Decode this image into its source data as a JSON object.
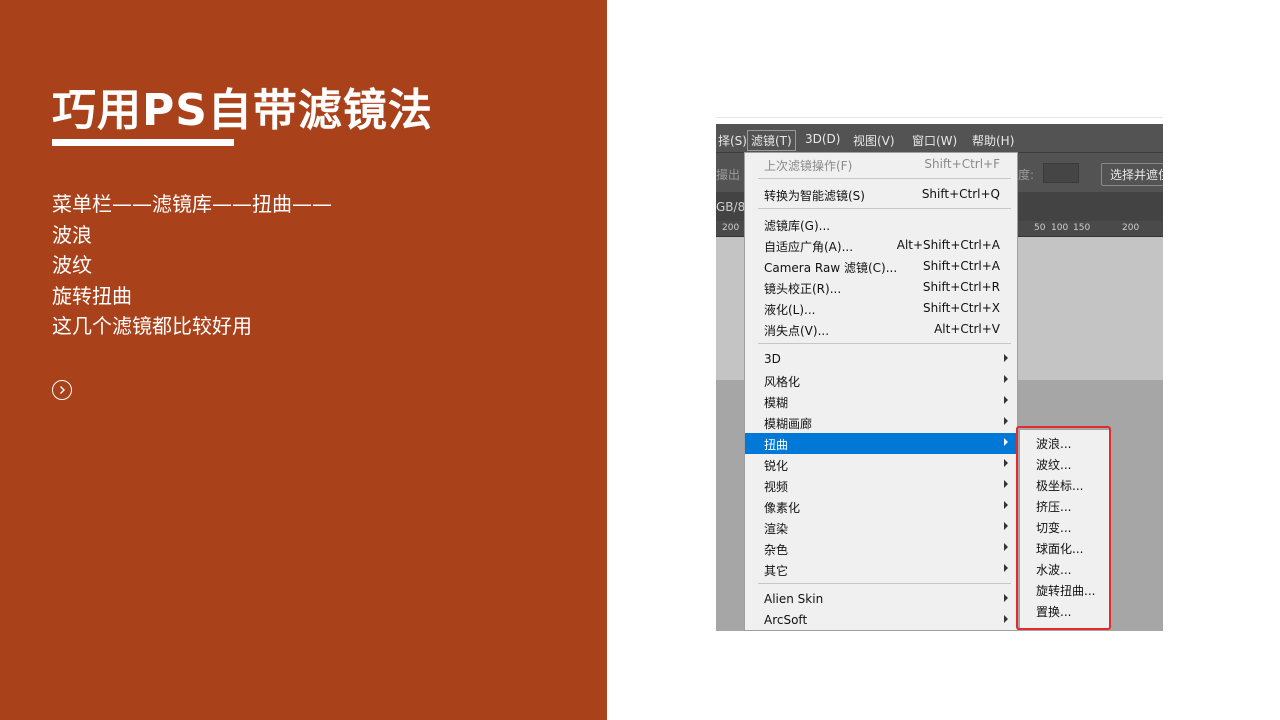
{
  "slide": {
    "title": "巧用PS自带滤镜法",
    "body_lines": [
      "菜单栏——滤镜库——扭曲——",
      "波浪",
      "波纹",
      "旋转扭曲",
      "这几个滤镜都比较好用"
    ],
    "next_button_icon": "chevron-right-circle-icon",
    "panel_color": "#a9411b"
  },
  "photoshop": {
    "menubar": {
      "items": [
        {
          "label": "择(S)"
        },
        {
          "label": "滤镜(T)",
          "active": true
        },
        {
          "label": "3D(D)"
        },
        {
          "label": "视图(V)"
        },
        {
          "label": "窗口(W)"
        },
        {
          "label": "帮助(H)"
        }
      ]
    },
    "options_bar": {
      "left_fragment": "撮出",
      "opacity_label": "度:",
      "select_mask_button": "选择并遮住"
    },
    "doc_tab": {
      "fragment": "GB/8"
    },
    "ruler": {
      "ticks": [
        "200",
        "50",
        "100",
        "150",
        "200"
      ]
    },
    "filter_menu": {
      "group1": [
        {
          "label": "上次滤镜操作(F)",
          "shortcut": "Shift+Ctrl+F",
          "disabled": true
        }
      ],
      "group2": [
        {
          "label": "转换为智能滤镜(S)",
          "shortcut": "Shift+Ctrl+Q"
        }
      ],
      "group3": [
        {
          "label": "滤镜库(G)...",
          "shortcut": ""
        },
        {
          "label": "自适应广角(A)...",
          "shortcut": "Alt+Shift+Ctrl+A"
        },
        {
          "label": "Camera Raw 滤镜(C)...",
          "shortcut": "Shift+Ctrl+A"
        },
        {
          "label": "镜头校正(R)...",
          "shortcut": "Shift+Ctrl+R"
        },
        {
          "label": "液化(L)...",
          "shortcut": "Shift+Ctrl+X"
        },
        {
          "label": "消失点(V)...",
          "shortcut": "Alt+Ctrl+V"
        }
      ],
      "group4": [
        {
          "label": "3D"
        },
        {
          "label": "风格化"
        },
        {
          "label": "模糊"
        },
        {
          "label": "模糊画廊"
        },
        {
          "label": "扭曲",
          "highlighted": true
        },
        {
          "label": "锐化"
        },
        {
          "label": "视频"
        },
        {
          "label": "像素化"
        },
        {
          "label": "渲染"
        },
        {
          "label": "杂色"
        },
        {
          "label": "其它"
        }
      ],
      "group5": [
        {
          "label": "Alien Skin"
        },
        {
          "label": "ArcSoft"
        }
      ]
    },
    "distort_submenu": [
      "波浪...",
      "波纹...",
      "极坐标...",
      "挤压...",
      "切变...",
      "球面化...",
      "水波...",
      "旋转扭曲...",
      "置换..."
    ],
    "colors": {
      "highlight": "#0078d7",
      "callout_border": "#e32b2b",
      "menubar_bg": "#535353"
    }
  }
}
